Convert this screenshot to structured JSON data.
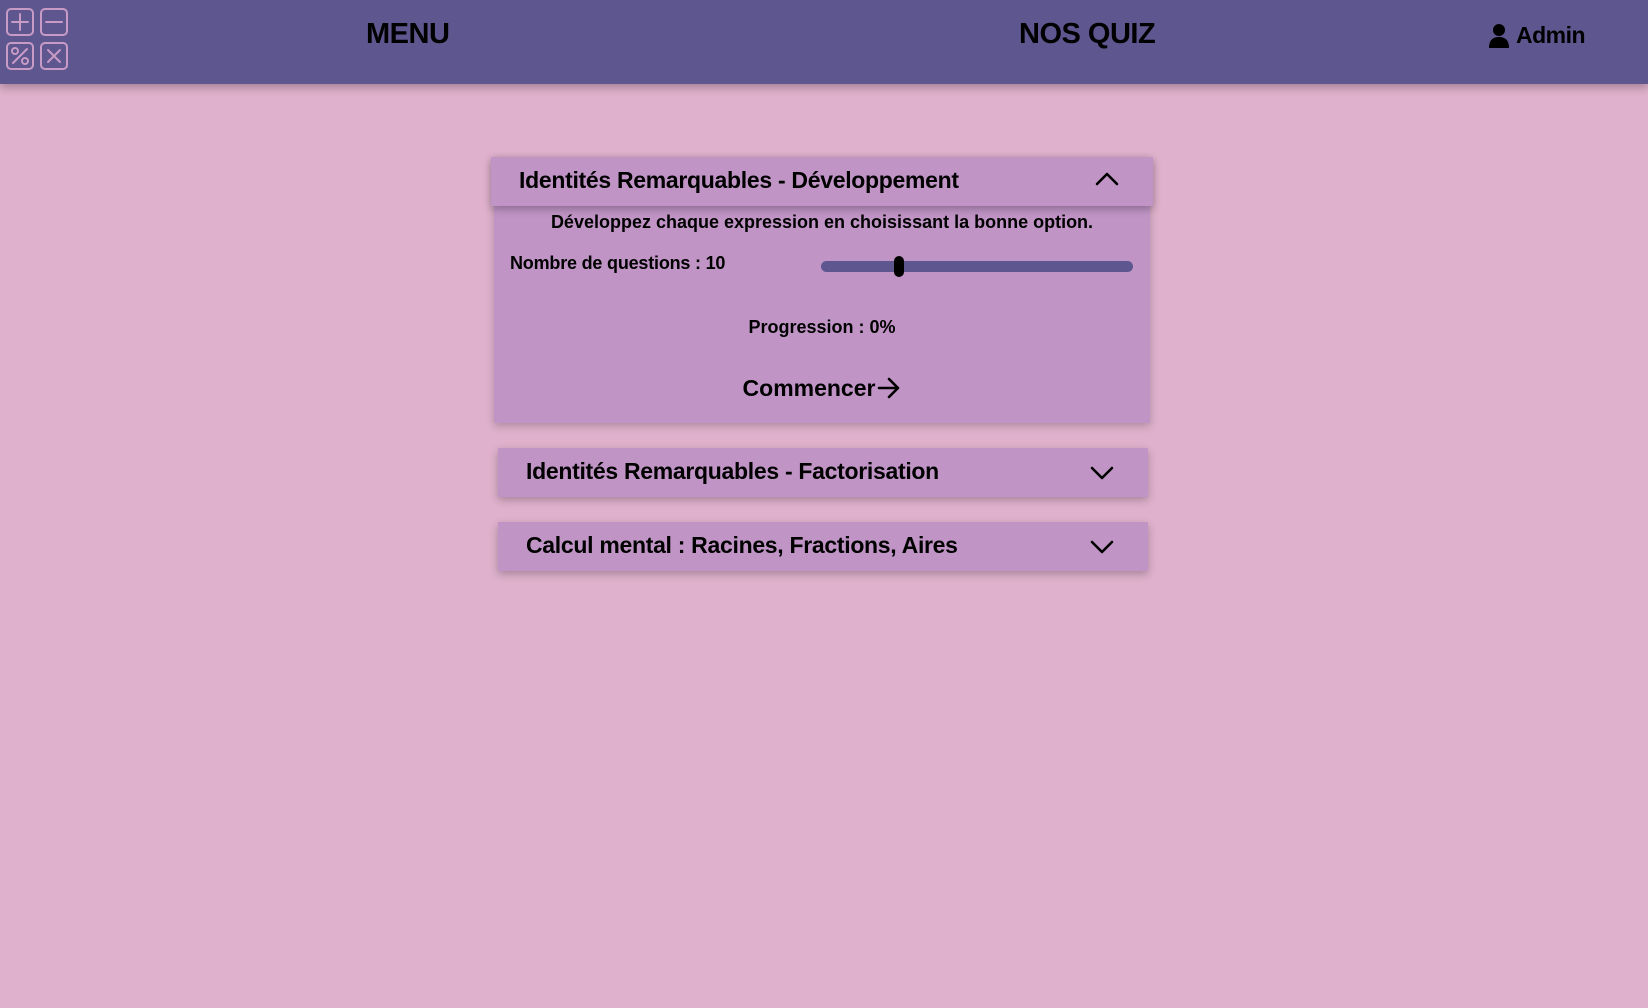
{
  "header": {
    "logo_icons": [
      "plus-icon",
      "minus-icon",
      "percent-icon",
      "multiply-icon"
    ],
    "menu_label": "MENU",
    "quiz_label": "NOS QUIZ",
    "admin_label": "Admin",
    "admin_icon": "user-icon"
  },
  "quizzes": [
    {
      "title": "Identités Remarquables - Développement",
      "expanded": true,
      "description": "Développez chaque expression en choisissant la bonne option.",
      "questions_label": "Nombre de questions : 10",
      "questions_value": 10,
      "slider_fraction": 0.25,
      "progress_label": "Progression : 0%",
      "start_label": "Commencer"
    },
    {
      "title": "Identités Remarquables - Factorisation",
      "expanded": false
    },
    {
      "title": "Calcul mental : Racines, Fractions, Aires",
      "expanded": false
    }
  ],
  "colors": {
    "background": "#dfb1cc",
    "header": "#5e568e",
    "card": "#c095c6",
    "slider_track": "#5e568e",
    "logo_outline": "#c79bc6"
  }
}
